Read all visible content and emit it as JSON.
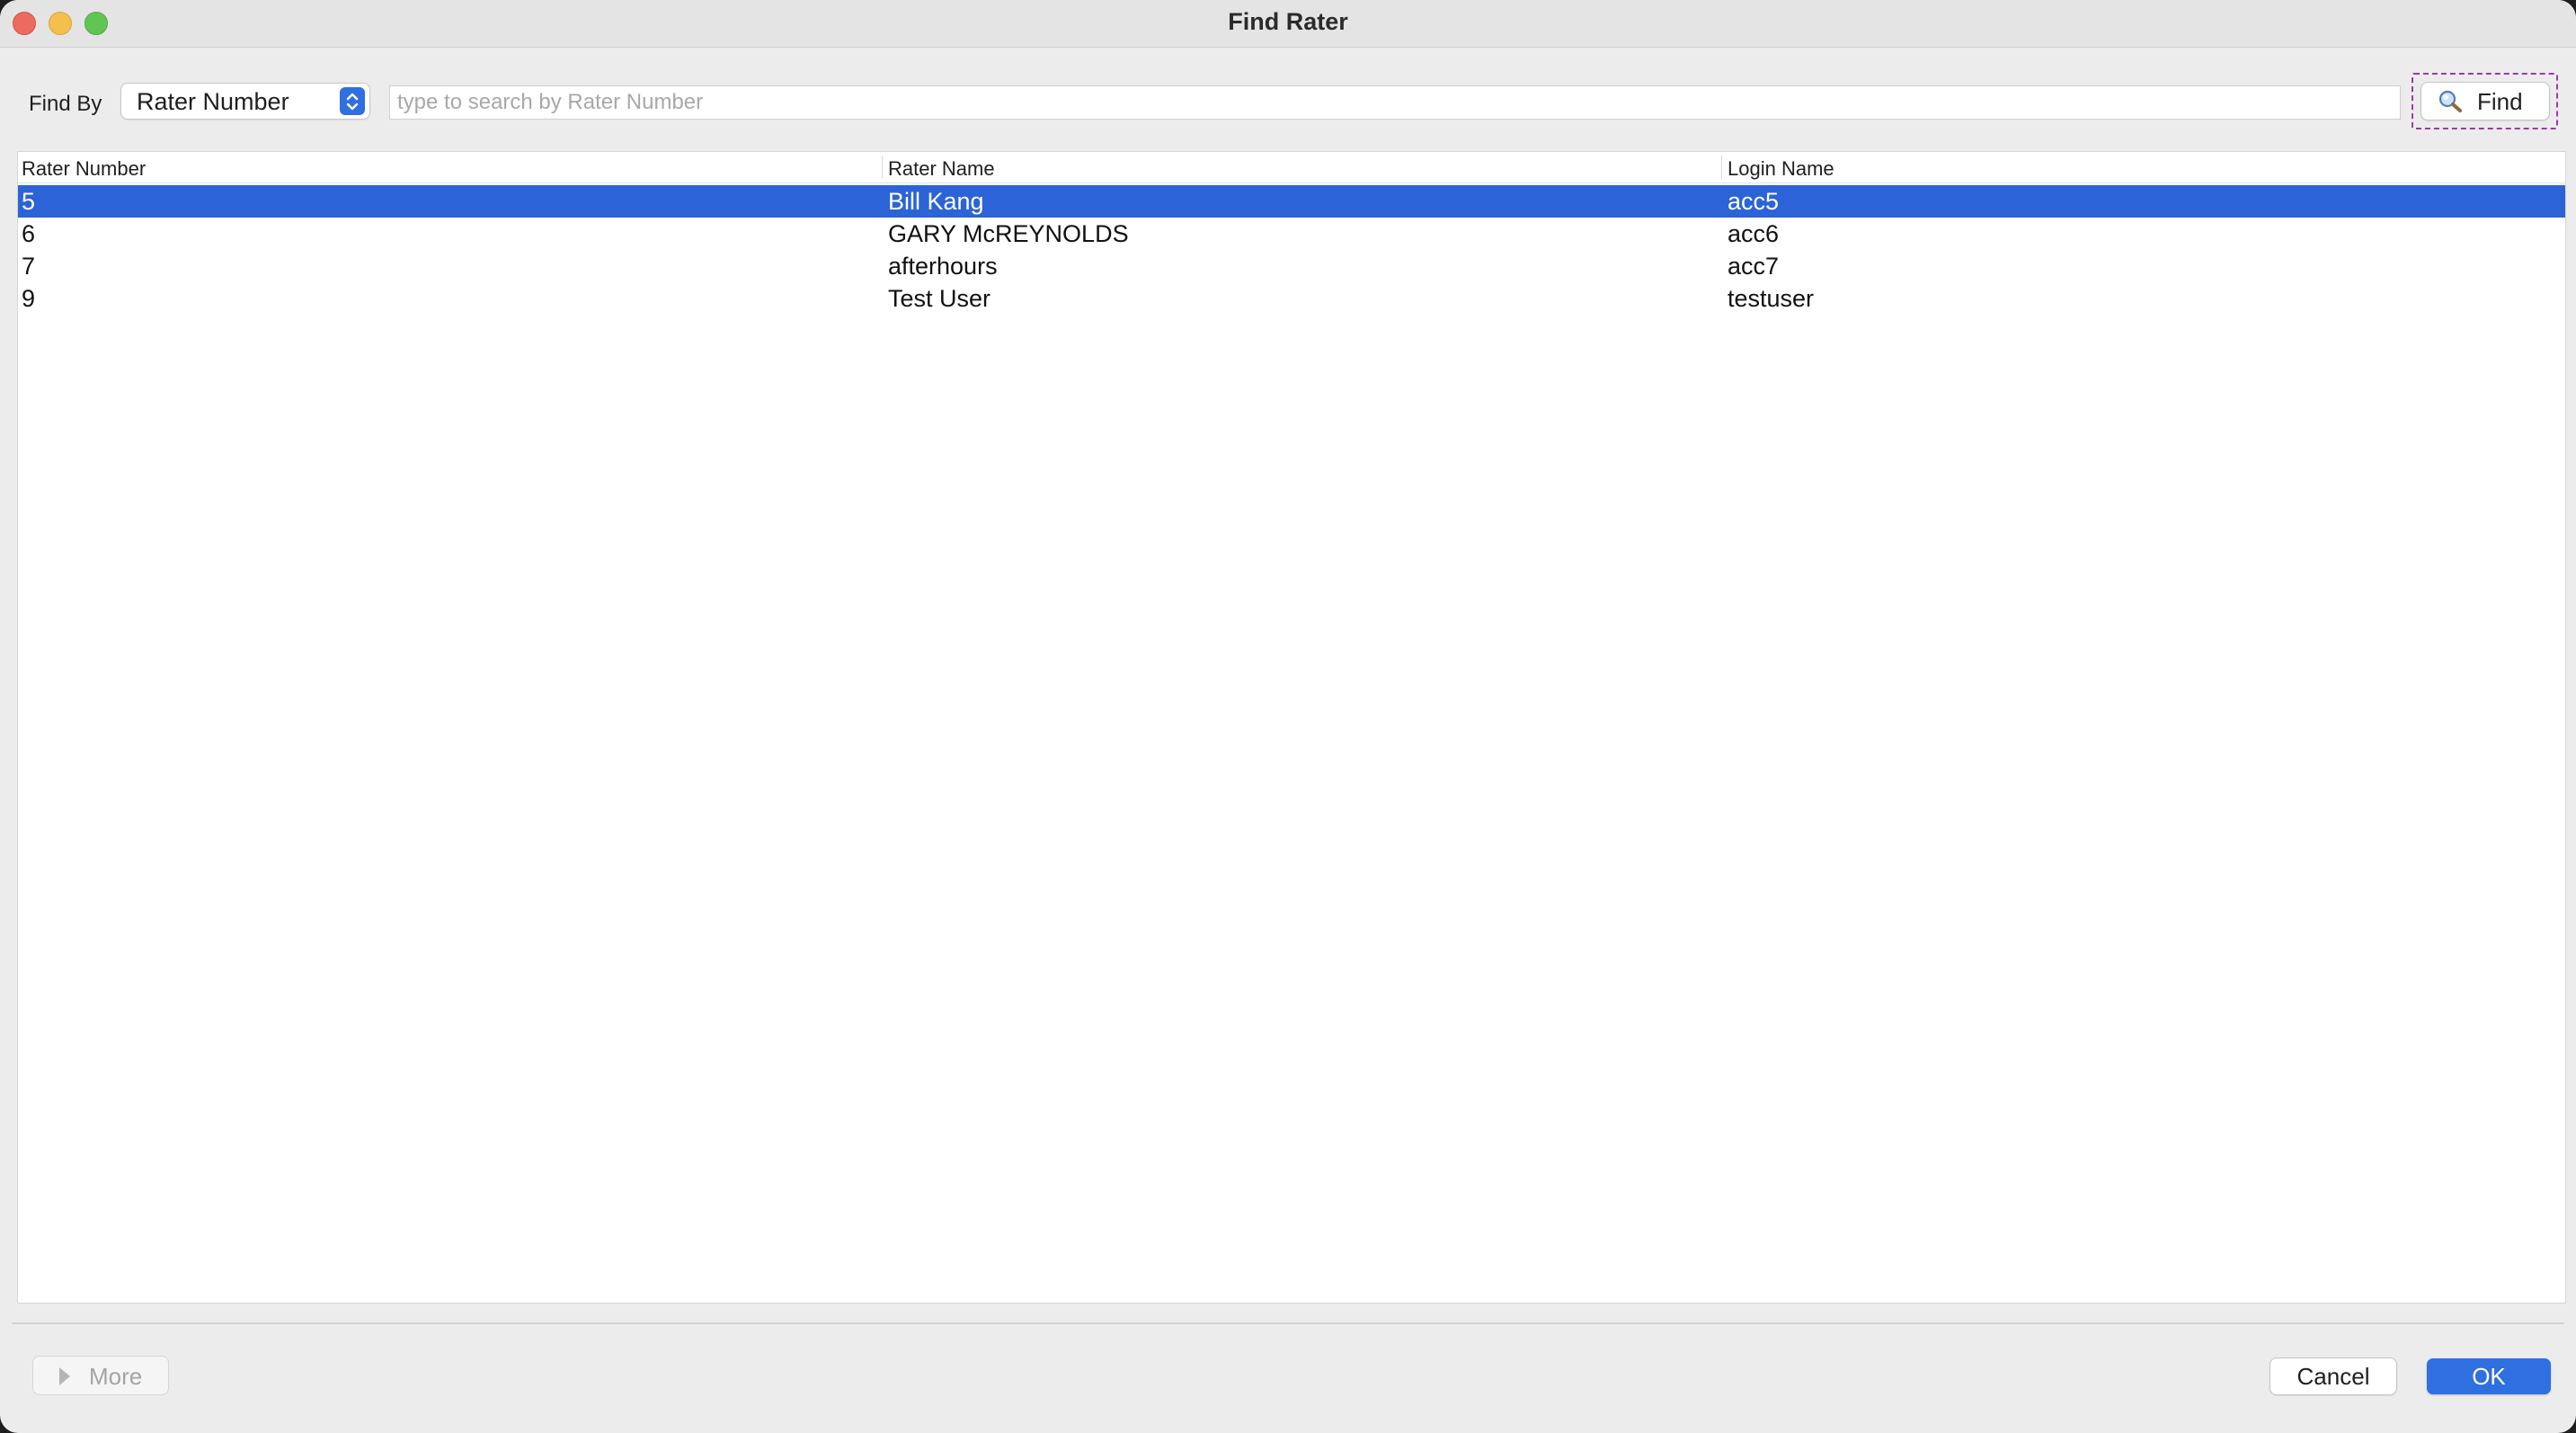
{
  "window": {
    "title": "Find Rater"
  },
  "find_bar": {
    "label": "Find By",
    "field_selected": "Rater Number",
    "search_placeholder": "type to search by Rater Number",
    "search_value": "",
    "find_button_label": "Find",
    "find_icon": "magnifying-glass-icon"
  },
  "table": {
    "columns": [
      "Rater Number",
      "Rater Name",
      "Login Name"
    ],
    "rows": [
      {
        "rater_number": "5",
        "rater_name": "Bill Kang",
        "login_name": "acc5",
        "selected": true
      },
      {
        "rater_number": "6",
        "rater_name": "GARY McREYNOLDS",
        "login_name": "acc6",
        "selected": false
      },
      {
        "rater_number": "7",
        "rater_name": "afterhours",
        "login_name": "acc7",
        "selected": false
      },
      {
        "rater_number": "9",
        "rater_name": "Test User",
        "login_name": "testuser",
        "selected": false
      }
    ]
  },
  "footer": {
    "more_label": "More",
    "more_icon": "disclosure-triangle-icon",
    "cancel_label": "Cancel",
    "ok_label": "OK"
  },
  "colors": {
    "selection": "#2c63d7",
    "accent": "#2f6fe0",
    "focus_outline": "#9b3aa5"
  }
}
